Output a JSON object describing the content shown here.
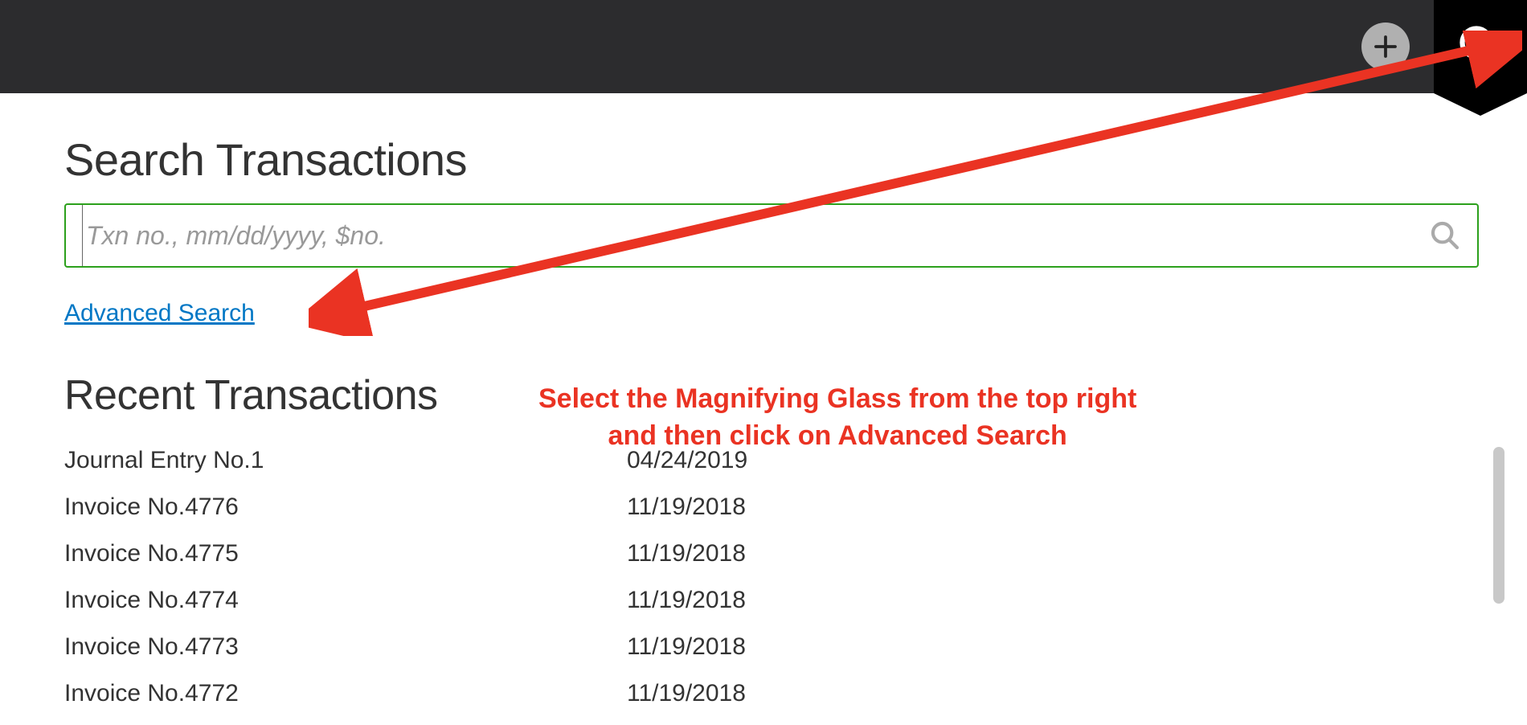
{
  "header": {
    "search_title": "Search Transactions",
    "search_placeholder": "Txn no., mm/dd/yyyy, $no.",
    "advanced_label": "Advanced Search",
    "recent_title": "Recent Transactions"
  },
  "annotation": {
    "line1": "Select the Magnifying Glass from the top right",
    "line2": "and then click on Advanced Search"
  },
  "transactions": [
    {
      "name": "Journal Entry No.1",
      "date": "04/24/2019"
    },
    {
      "name": "Invoice No.4776",
      "date": "11/19/2018"
    },
    {
      "name": "Invoice No.4775",
      "date": "11/19/2018"
    },
    {
      "name": "Invoice No.4774",
      "date": "11/19/2018"
    },
    {
      "name": "Invoice No.4773",
      "date": "11/19/2018"
    },
    {
      "name": "Invoice No.4772",
      "date": "11/19/2018"
    }
  ]
}
